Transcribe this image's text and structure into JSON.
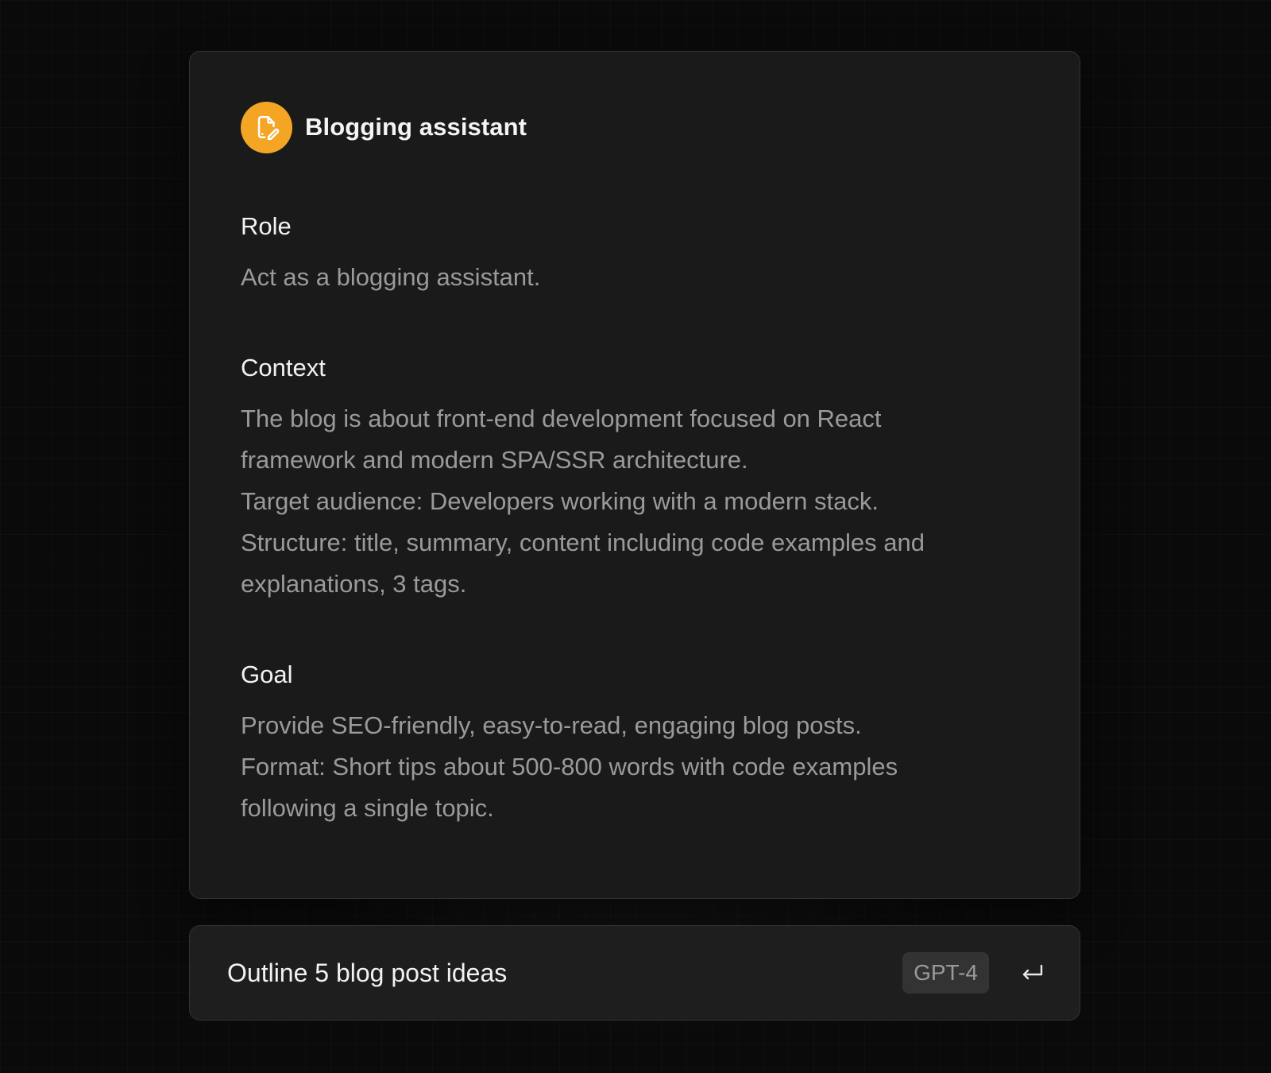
{
  "assistant": {
    "title": "Blogging assistant",
    "icon": "document-edit-icon",
    "accent_color": "#f5a524"
  },
  "sections": {
    "role": {
      "heading": "Role",
      "lines": [
        "Act as a blogging assistant."
      ]
    },
    "context": {
      "heading": "Context",
      "lines": [
        "The blog is about front-end development focused on React",
        "framework and modern SPA/SSR architecture.",
        "Target audience: Developers working with a modern stack.",
        "Structure: title, summary, content including code examples and",
        "explanations, 3 tags."
      ]
    },
    "goal": {
      "heading": "Goal",
      "lines": [
        "Provide SEO-friendly, easy-to-read, engaging blog posts.",
        "Format: Short tips about 500-800 words with code examples",
        "following a single topic."
      ]
    }
  },
  "prompt": {
    "value": "Outline 5 blog post ideas",
    "model": "GPT-4",
    "submit_icon": "enter-return-icon"
  }
}
